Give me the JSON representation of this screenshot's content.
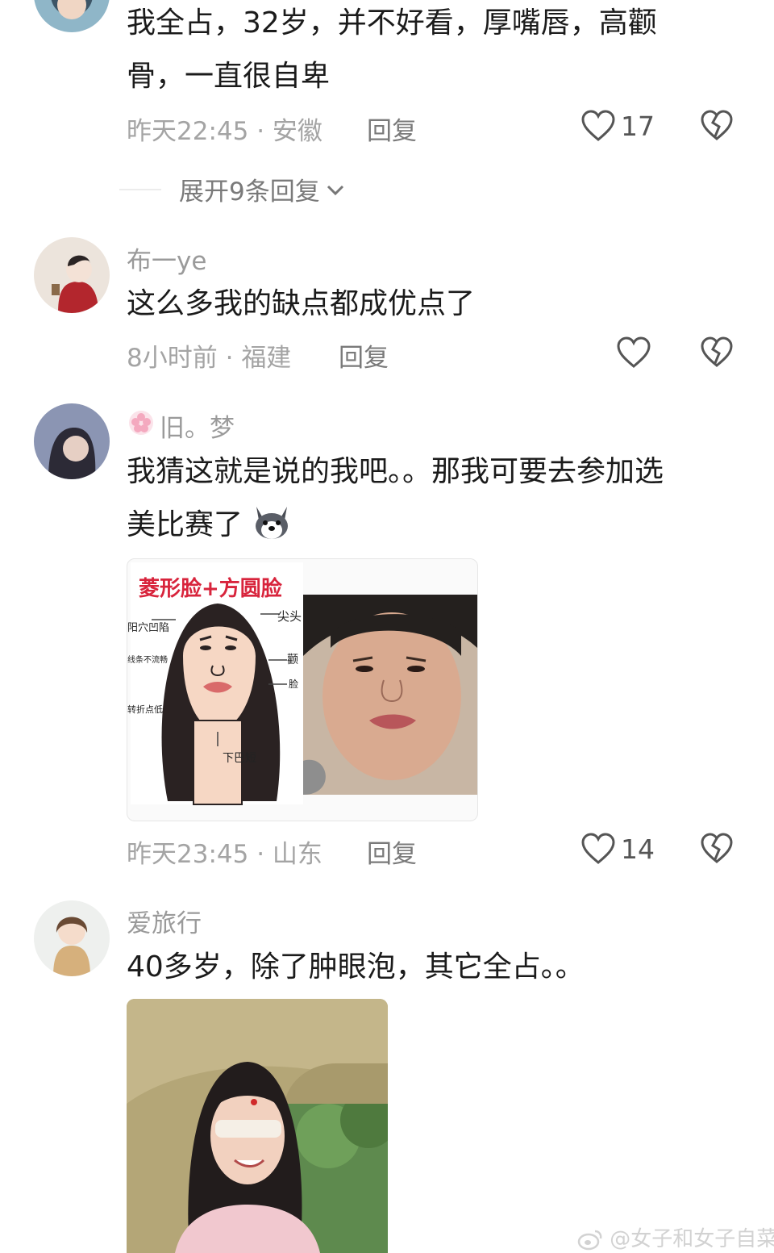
{
  "comments": [
    {
      "text_lines": [
        "我全占，32岁，并不好看，厚嘴唇，高颧",
        "骨，一直很自卑"
      ],
      "time": "昨天22:45",
      "location": "安徽",
      "reply_label": "回复",
      "likes": "17",
      "expand_label": "展开9条回复"
    },
    {
      "username": "布一ye",
      "text": "这么多我的缺点都成优点了",
      "time": "8小时前",
      "location": "福建",
      "reply_label": "回复"
    },
    {
      "username": "旧。梦",
      "text_lines": [
        "我猜这就是说的我吧。。那我可要去参加选",
        "美比赛了"
      ],
      "time": "昨天23:45",
      "location": "山东",
      "reply_label": "回复",
      "likes": "14",
      "image": {
        "title": "菱形脸+方圆脸",
        "labels": [
          "阳穴凹陷",
          "线条不流畅",
          "转折点低",
          "尖头",
          "颧",
          "脸",
          "下巴短"
        ]
      }
    },
    {
      "username": "爱旅行",
      "text": "40多岁，除了肿眼泡，其它全占。。"
    }
  ],
  "watermark": "@女子和女子自菜",
  "colors": {
    "meta": "#a4a4a4",
    "title_red": "#d8243c"
  }
}
